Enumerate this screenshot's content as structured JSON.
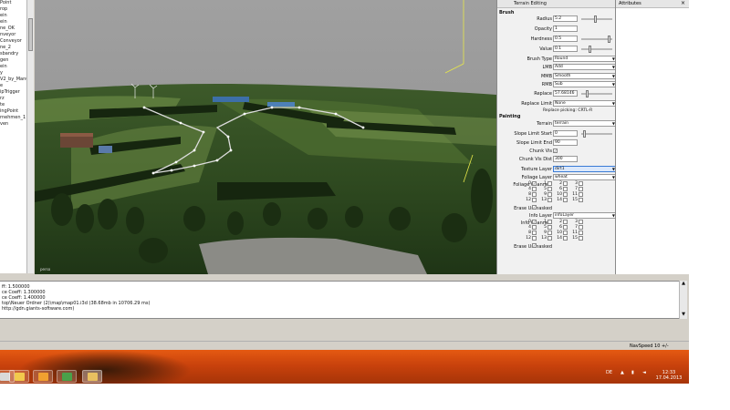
{
  "scene_tree": {
    "items": [
      "Point",
      "rop",
      "ein",
      "ein",
      "",
      "",
      "",
      "",
      "",
      "",
      "",
      "",
      "ne_OK",
      "nveyor",
      "Conveyor",
      "ne_2",
      "sbandry",
      "",
      "",
      "gen",
      "ein",
      "",
      "",
      "",
      "",
      "",
      "",
      "",
      "",
      "y",
      "",
      "",
      "V2_by_Manu",
      "e",
      "",
      "ipTrigger",
      "rz",
      "",
      "te",
      "",
      "ingPoint",
      "rnehmen_1",
      "",
      "",
      "ven"
    ]
  },
  "viewport": {
    "label": "perso"
  },
  "terrain_panel": {
    "title": "Terrain Editing",
    "brush_header": "Brush",
    "radius_label": "Radius",
    "radius_value": "5.2",
    "radius_level": 0.45,
    "opacity_label": "Opacity",
    "opacity_value": "1",
    "hardness_label": "Hardness",
    "hardness_value": "0.5",
    "hardness_level": 0.95,
    "value_label": "Value",
    "value_value": "0.1",
    "value_level": 0.25,
    "brush_type_label": "Brush Type",
    "brush_type_value": "Round",
    "lmb_label": "LMB",
    "lmb_value": "Add",
    "mmb_label": "MMB",
    "mmb_value": "Smooth",
    "rmb_label": "RMB",
    "rmb_value": "Sub",
    "replace_label": "Replace",
    "replace_value": "57.68146",
    "replace_level": 0.15,
    "replace_limit_label": "Replace Limit",
    "replace_limit_value": "None",
    "replace_picking_hint": "Replace picking: CRTL-R",
    "painting_header": "Painting",
    "terrain_label": "Terrain",
    "terrain_value": "terrain",
    "slope_start_label": "Slope Limit Start",
    "slope_start_value": "0",
    "slope_start_level": 0.05,
    "slope_end_label": "Slope Limit End",
    "slope_end_value": "90",
    "chunk_vis_label": "Chunk Vis",
    "chunk_vis_checked": true,
    "chunk_vis_dist_label": "Chunk Vis Dist",
    "chunk_vis_dist_value": "300",
    "texture_layer_label": "Texture Layer",
    "texture_layer_value": "dirt1",
    "foliage_layer_label": "Foliage Layer",
    "foliage_layer_value": "wheat",
    "foliage_channels_label": "Foliage Channels",
    "foliage_channels": [
      "0",
      "1",
      "2",
      "3",
      "4",
      "5",
      "6",
      "7",
      "8",
      "9",
      "10",
      "11",
      "12",
      "13",
      "14",
      "15"
    ],
    "erase_unmasked_label": "Erase Unmasked",
    "info_layer_label": "Info Layer",
    "info_layer_value": "infoLayer",
    "info_channels_label": "Info Channels",
    "info_channels": [
      "0",
      "1",
      "2",
      "3",
      "4",
      "5",
      "6",
      "7",
      "8",
      "9",
      "10",
      "11",
      "12",
      "13",
      "14",
      "15"
    ],
    "erase_unmasked2_label": "Erase Unmasked"
  },
  "attributes_panel": {
    "title": "Attributes",
    "close_glyph": "×"
  },
  "console": {
    "lines": [
      "ff: 1.500000",
      "ce Coeff: 1.300000",
      "ce Coeff: 1.400000",
      "top\\Neuer Ordner (2)\\map\\map01.i3d (38.68mb in 10706.29 ms)",
      "http://gdn.giants-software.com)"
    ]
  },
  "status_bar": {
    "navspeed": "NavSpeed 10 +/-"
  },
  "taskbar": {
    "lang": "DE",
    "time": "12:33",
    "date": "17.04.2013",
    "colors": {
      "start": "#e55a12",
      "end": "#a63408"
    }
  }
}
